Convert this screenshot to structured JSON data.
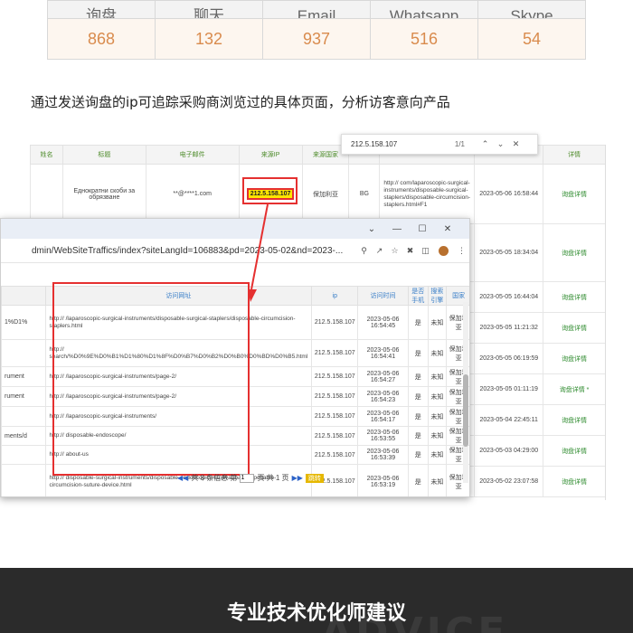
{
  "stats": {
    "headers": [
      "询盘",
      "聊天",
      "Email",
      "Whatsapp",
      "Skype"
    ],
    "values": [
      "868",
      "132",
      "937",
      "516",
      "54"
    ]
  },
  "caption": "通过发送询盘的ip可追踪采购商浏览过的具体页面，分析访客意向产品",
  "find_bar": {
    "query": "212.5.158.107",
    "count": "1/1"
  },
  "admin_table": {
    "headers": [
      "姓名",
      "标题",
      "电子邮件",
      "来源IP",
      "来源国家",
      "",
      "",
      "",
      "详情"
    ],
    "rows": [
      {
        "title": "Еднократни скоби за обрязване",
        "email": "**@****1.com",
        "ip": "212.5.158.107",
        "country": "保加利亚",
        "flag": "BG",
        "url": "http:// com/laparoscopic-surgical-instruments/disposable-surgical-staplers/disposable-circumcision-staplers.html#F1",
        "time": "2023-05-06 16:58:44",
        "detail": "询盘详情"
      },
      {
        "time": "2023-05-05 18:34:04",
        "detail": "询盘详情"
      },
      {
        "time": "2023-05-05 16:44:04",
        "detail": "询盘详情"
      },
      {
        "time": "2023-05-05 11:21:32",
        "detail": "询盘详情"
      },
      {
        "time": "2023-05-05 06:19:59",
        "detail": "询盘详情"
      },
      {
        "time": "2023-05-05 01:11:19",
        "detail": "询盘详情 *"
      },
      {
        "time": "2023-05-04 22:45:11",
        "detail": "询盘详情"
      },
      {
        "time": "2023-05-03 04:29:00",
        "detail": "询盘详情"
      },
      {
        "time": "2023-05-02 23:07:58",
        "detail": "询盘详情"
      }
    ]
  },
  "browser": {
    "address": "dmin/WebSiteTraffics/index?siteLangId=106883&pd=2023-05-02&nd=2023-...",
    "title_controls": [
      "⌄",
      "—",
      "☐",
      "✕"
    ]
  },
  "visits_table": {
    "headers": [
      "访问网址",
      "ip",
      "访问时间",
      "是否手机",
      "搜索引擎",
      "国家"
    ],
    "left_fragments": [
      "1%D1%",
      "",
      "rument",
      "rument",
      "",
      "ments/d",
      "",
      ""
    ],
    "rows": [
      {
        "url": "http:// /laparoscopic-surgical-instruments/disposable-surgical-staplers/disposable-circumcision-staplers.html",
        "ip": "212.5.158.107",
        "time": "2023-05-06 16:54:45",
        "mobile": "是",
        "engine": "未知",
        "country": "保加利亚"
      },
      {
        "url": "http:// search/%D0%9E%D0%B1%D1%80%D1%8F%D0%B7%D0%B2%D0%B0%D0%BD%D0%B5.html",
        "ip": "212.5.158.107",
        "time": "2023-05-06 16:54:41",
        "mobile": "是",
        "engine": "未知",
        "country": "保加利亚"
      },
      {
        "url": "http:// /laparoscopic-surgical-instruments/page-2/",
        "ip": "212.5.158.107",
        "time": "2023-05-06 16:54:27",
        "mobile": "是",
        "engine": "未知",
        "country": "保加利亚"
      },
      {
        "url": "http:// /laparoscopic-surgical-instruments/page-2/",
        "ip": "212.5.158.107",
        "time": "2023-05-06 16:54:23",
        "mobile": "是",
        "engine": "未知",
        "country": "保加利亚"
      },
      {
        "url": "http:// /laparoscopic-surgical-instruments/",
        "ip": "212.5.158.107",
        "time": "2023-05-06 16:54:17",
        "mobile": "是",
        "engine": "未知",
        "country": "保加利亚"
      },
      {
        "url": "http:// disposable-endoscope/",
        "ip": "212.5.158.107",
        "time": "2023-05-06 16:53:55",
        "mobile": "是",
        "engine": "未知",
        "country": "保加利亚"
      },
      {
        "url": "http:// about-us",
        "ip": "212.5.158.107",
        "time": "2023-05-06 16:53:39",
        "mobile": "是",
        "engine": "未知",
        "country": "保加利亚"
      },
      {
        "url": "http:// disposable-surgical-instruments/disposable-endoscopic-retrieval-bag/disposable-circumcision-suture-device.html",
        "ip": "212.5.158.107",
        "time": "2023-05-06 16:53:19",
        "mobile": "是",
        "engine": "未知",
        "country": "保加利亚"
      }
    ]
  },
  "pager": {
    "prev": "◀◀",
    "text1": "共 8 条信息 第",
    "page": "1",
    "text2": "页 共 1 页",
    "next": "▶▶",
    "go": "跳转"
  },
  "banner": {
    "title": "专业技术优化师建议",
    "bg_text": "ADVICE"
  },
  "colors": {
    "accent_red": "#e53030",
    "link_green": "#1e8a1e",
    "stat_orange": "#d98b4d",
    "highlight": "#ffe600"
  }
}
